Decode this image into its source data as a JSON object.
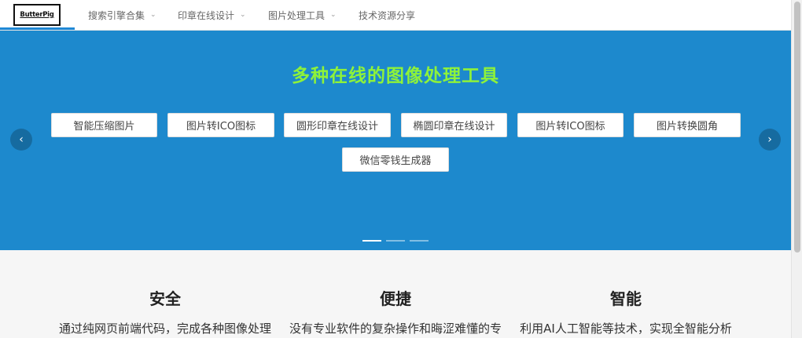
{
  "header": {
    "logo_text": "ButterPig",
    "nav": [
      {
        "label": "搜索引擎合集",
        "has_dropdown": true
      },
      {
        "label": "印章在线设计",
        "has_dropdown": true
      },
      {
        "label": "图片处理工具",
        "has_dropdown": true
      },
      {
        "label": "技术资源分享",
        "has_dropdown": false
      }
    ],
    "dropdown_icon": "chevron-down-icon"
  },
  "hero": {
    "title": "多种在线的图像处理工具",
    "background_color": "#1d89cd",
    "title_color": "#8ef23a",
    "tools": [
      {
        "label": "智能压缩图片"
      },
      {
        "label": "图片转ICO图标"
      },
      {
        "label": "圆形印章在线设计"
      },
      {
        "label": "椭圆印章在线设计"
      },
      {
        "label": "图片转ICO图标"
      },
      {
        "label": "图片转换圆角"
      },
      {
        "label": "微信零钱生成器"
      }
    ],
    "prev_icon": "chevron-left-icon",
    "next_icon": "chevron-right-icon",
    "slides_count": 3,
    "active_slide": 1
  },
  "features": [
    {
      "title": "安全",
      "text": "通过纯网页前端代码，完成各种图像处理"
    },
    {
      "title": "便捷",
      "text": "没有专业软件的复杂操作和晦涩难懂的专"
    },
    {
      "title": "智能",
      "text": "利用AI人工智能等技术，实现全智能分析"
    }
  ]
}
